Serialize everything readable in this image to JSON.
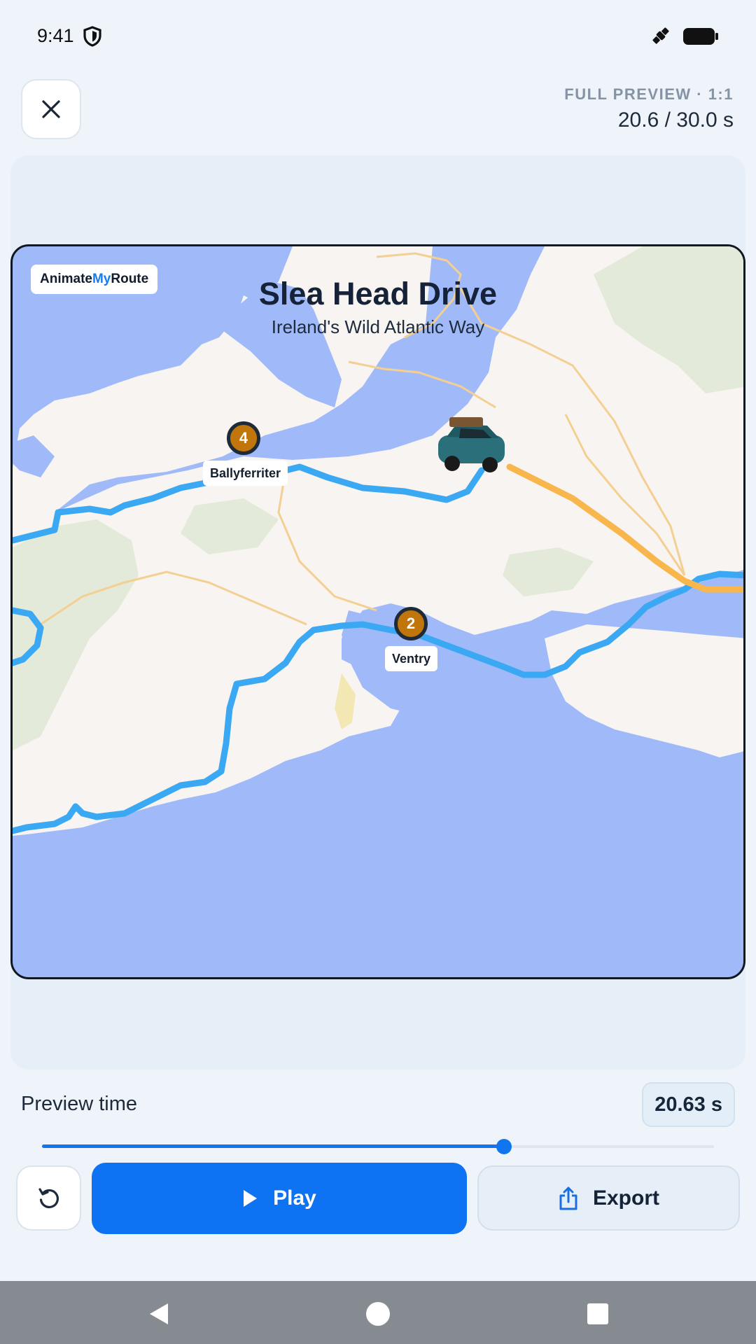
{
  "status_bar": {
    "time": "9:41",
    "icons": [
      "shield-icon",
      "satellite-icon",
      "battery-icon"
    ]
  },
  "header": {
    "close_icon": "close-icon",
    "preview_label": "FULL PREVIEW · 1:1",
    "playback_time": "20.6 / 30.0 s"
  },
  "map": {
    "brand_prefix": "Animate",
    "brand_accent": "My",
    "brand_suffix": "Route",
    "title": "Slea Head Drive",
    "subtitle": "Ireland's Wild Atlantic Way",
    "waypoints": [
      {
        "number": "4",
        "label": "Ballyferriter"
      },
      {
        "number": "2",
        "label": "Ventry"
      }
    ],
    "vehicle_icon": "car-icon",
    "colors": {
      "sea": "#a0baf9",
      "land": "#f7f4f1",
      "route": "#3aa8f3",
      "route_progress": "#f9b64d",
      "waypoint": "#c1760b"
    }
  },
  "scrubber": {
    "label": "Preview time",
    "value": "20.63 s",
    "progress": 0.688
  },
  "actions": {
    "reset_icon": "reset-icon",
    "play_label": "Play",
    "export_label": "Export"
  },
  "nav_bar": {
    "icons": [
      "back-icon",
      "home-icon",
      "recents-icon"
    ]
  }
}
